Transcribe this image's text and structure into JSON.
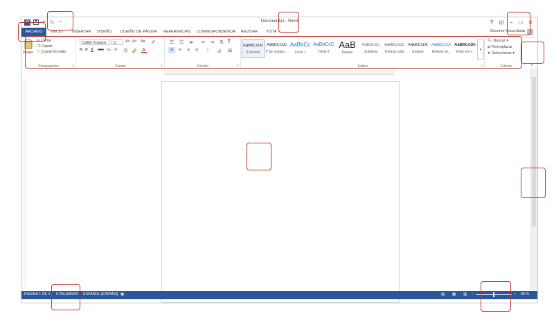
{
  "title_bar": {
    "title": "Documento1 - Word",
    "help": "?",
    "ribbon_display": "⊡",
    "minimize": "–",
    "maximize": "□",
    "close": "✕"
  },
  "quick_access": {
    "save_icon": "save-icon",
    "undo_icon": "undo-icon",
    "redo_icon": "redo-icon",
    "customize": "="
  },
  "tabs": [
    {
      "label": "ARCHIVO"
    },
    {
      "label": "INICIO"
    },
    {
      "label": "INSERTAR"
    },
    {
      "label": "DISEÑO"
    },
    {
      "label": "DISEÑO DE PÁGINA"
    },
    {
      "label": "REFERENCIAS"
    },
    {
      "label": "CORRESPONDENCIA"
    },
    {
      "label": "REVISAR"
    },
    {
      "label": "VISTA"
    }
  ],
  "user": {
    "name": "Docente Secundaria"
  },
  "clipboard": {
    "paste": "Pegar",
    "cut": "Cortar",
    "copy": "Copiar",
    "format_painter": "Copiar formato",
    "label": "Portapapeles"
  },
  "font": {
    "name": "Calibri (Cuerpo",
    "size": "11",
    "bold": "N",
    "italic": "K",
    "underline": "S",
    "strike": "abc",
    "sub": "x₂",
    "sup": "x²",
    "grow": "A˄",
    "shrink": "A˅",
    "case": "Aa",
    "label": "Fuente"
  },
  "paragraph": {
    "label": "Párrafo",
    "marks": "¶"
  },
  "styles": {
    "label": "Estilos",
    "items": [
      {
        "sample": "AaBbCcDc",
        "name": "¶ Normal"
      },
      {
        "sample": "AaBbCcDc",
        "name": "¶ Sin espaci..."
      },
      {
        "sample": "AaBbCc",
        "name": "Título 1"
      },
      {
        "sample": "AaBbCcC",
        "name": "Título 2"
      },
      {
        "sample": "AaB",
        "name": "Puesto"
      },
      {
        "sample": "AaBbCcC",
        "name": "Subtítulo"
      },
      {
        "sample": "AaBbCcDc",
        "name": "Énfasis sutil"
      },
      {
        "sample": "AaBbCcDc",
        "name": "Énfasis"
      },
      {
        "sample": "AaBbCcDc",
        "name": "Énfasis int..."
      },
      {
        "sample": "AaBbCcDc",
        "name": "Texto en n..."
      }
    ]
  },
  "editing": {
    "find": "Buscar",
    "replace": "Reemplazar",
    "select": "Seleccionar",
    "label": "Edición"
  },
  "status": {
    "page": "PÁGINA 1 DE 1",
    "words": "0 PALABRAS",
    "language": "ESPAÑOL (ESPAÑA)",
    "zoom": "90 %",
    "zoom_minus": "–",
    "zoom_plus": "+"
  },
  "colors": {
    "accent": "#2b579a",
    "annotation": "#c0392b"
  }
}
